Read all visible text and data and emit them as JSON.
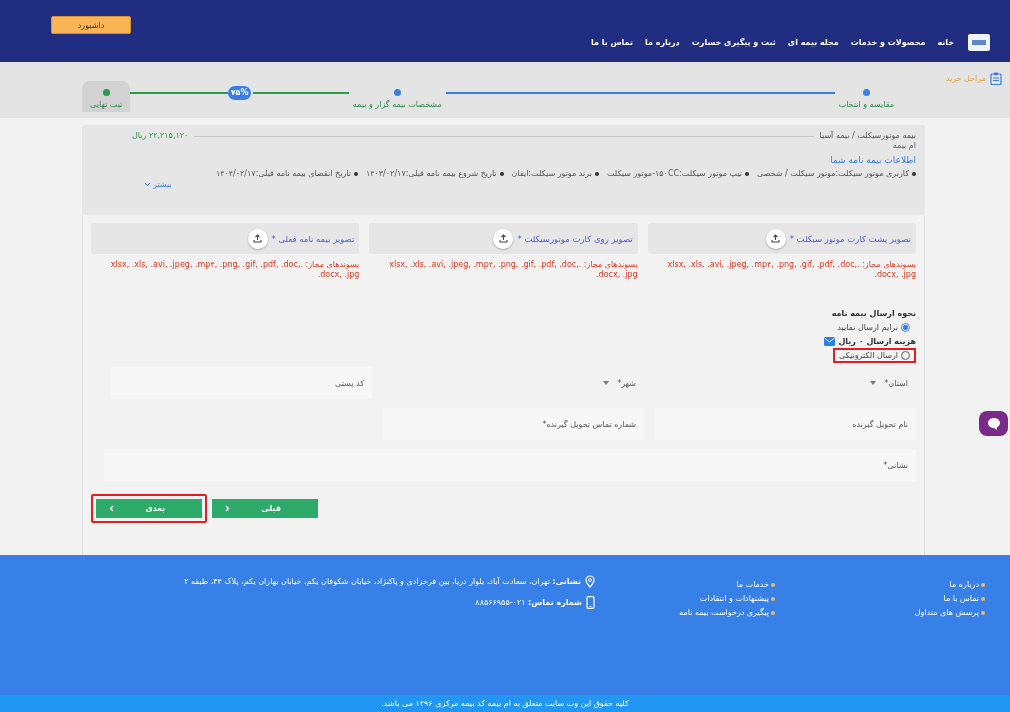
{
  "header": {
    "dashboard_button": "داشبورد",
    "nav": [
      "خانه",
      "محصولات و خدمات",
      "مجله بیمه ای",
      "ثبت و پیگیری خسارت",
      "درباره ما",
      "تماس با ما"
    ]
  },
  "stepper": {
    "title": "مراحل خرید",
    "progress": "۷۵%",
    "steps": [
      {
        "label": "مقایسه و انتخاب",
        "done": true,
        "selected": false
      },
      {
        "label": "مشخصات بیمه گزار و بیمه",
        "done": true,
        "selected": false
      },
      {
        "label": "ثبت نهایی",
        "done": false,
        "selected": true
      }
    ]
  },
  "summary": {
    "product": "بیمه موتورسیکلت / بیمه آسیا",
    "provider": "ام بیمه",
    "price": "۲۲,۲۱۵,۱۲۰ ریال",
    "title": "اطلاعات بیمه نامه شما",
    "details": [
      "کاربری موتور سیکلت:موتور سیکلت / شخصی",
      "تیپ موتور سیکلت:۱۵۰CC-موتور سیکلت",
      "برند موتور سیکلت:ایفان",
      "تاریخ شروع بیمه نامه قبلی:۱۴۰۳/۰۲/۱۷",
      "تاریخ انقضای بیمه نامه قبلی:۱۴۰۴/۰۲/۱۷"
    ],
    "more": "بیشتر"
  },
  "uploads": [
    {
      "label": "تصویر پشت کارت موتور سیکلت *",
      "allowed": "پسوندهای مجاز: .xlsx, .xls, .avi, .jpeg, .mp۴, .png, .gif, .pdf, .doc, .docx, .jpg"
    },
    {
      "label": "تصویر روی کارت موتورسیکلت *",
      "allowed": "پسوندهای مجاز: .xlsx, .xls, .avi, .jpeg, .mp۴, .png, .gif, .pdf, .doc, .docx, .jpg"
    },
    {
      "label": "تصویر بیمه نامه فعلی *",
      "allowed": "پسوندهای مجاز: .xlsx, .xls, .avi, .jpeg, .mp۴, .png, .gif, .pdf, .doc, .docx, .jpg"
    }
  ],
  "delivery": {
    "title": "نحوه ارسال بیمه نامه",
    "cost": "هزینه ارسال ۰ ریال",
    "options": [
      {
        "label": "برایم ارسال نمایید",
        "selected": true,
        "highlighted": false
      },
      {
        "label": "ارسال الکترونیکی",
        "selected": false,
        "highlighted": true
      }
    ]
  },
  "fields": [
    [
      {
        "placeholder": "استان*",
        "kind": "select"
      },
      {
        "placeholder": "شهر*",
        "kind": "select"
      },
      {
        "placeholder": "کد پستی",
        "kind": "text"
      }
    ],
    [
      {
        "placeholder": "نام تحویل گیرنده",
        "kind": "text"
      },
      {
        "placeholder": "شماره تماس تحویل گیرنده*",
        "kind": "text"
      }
    ],
    [
      {
        "placeholder": "نشانی*",
        "kind": "text"
      }
    ]
  ],
  "buttons": [
    {
      "label": "قبلی",
      "kind": "prev",
      "highlighted": false
    },
    {
      "label": "بعدی",
      "kind": "next",
      "highlighted": true
    }
  ],
  "footer": {
    "links_1": [
      "درباره ما",
      "تماس با ما",
      "پرسش های متداول"
    ],
    "links_2": [
      "خدمات ما",
      "پیشنهادات و انتقادات",
      "پیگیری درخواست بیمه نامه"
    ],
    "address_label": "نشانی:",
    "address": "تهران، سعادت آباد، بلوار دریا، بین فرحزادی و پاکنژاد، خیابان شکوفان یکم، خیابان بهاران یکم، پلاک ۳۴، طبقه ۲",
    "phone_label": "شماره تماس:",
    "phone": "۰۲۱-۸۸۵۶۶۹۵۵",
    "copyright": "کلیه حقوق این وب سایت متعلق به ام بیمه کد بیمه مرکزی ۱۲۹۶ می باشد."
  }
}
